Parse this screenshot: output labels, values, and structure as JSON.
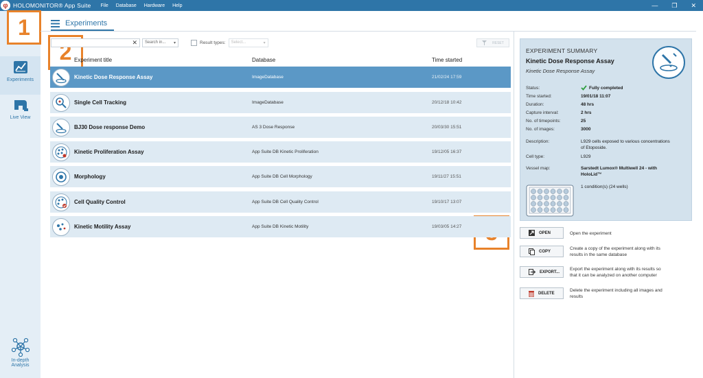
{
  "titlebar": {
    "logo_glyph": "φ",
    "app_name": "HOLOMONITOR® App Suite",
    "menu": [
      "File",
      "Database",
      "Hardware",
      "Help"
    ],
    "min_glyph": "—",
    "max_glyph": "❐",
    "close_glyph": "✕"
  },
  "sidebar": {
    "items": [
      {
        "label": "Experiments",
        "icon": "chart-icon"
      },
      {
        "label": "Live View",
        "icon": "microscope-icon"
      }
    ],
    "bottom": {
      "label_1": "In-depth",
      "label_2": "Analysis",
      "icon": "network-icon"
    }
  },
  "badges": {
    "b1": "1",
    "b2": "2",
    "b3": "3"
  },
  "header": {
    "tab_label": "Experiments",
    "tab_icon": "hamburger-icon"
  },
  "filter": {
    "clear_glyph": "✕",
    "search_in": "Search in...",
    "chevron": "▾",
    "result_types_label": "Result types:",
    "result_select_placeholder": "Select...",
    "reset_label": "RESET"
  },
  "table": {
    "columns": [
      "Experiment title",
      "Database",
      "Time started"
    ],
    "rows": [
      {
        "title": "Kinetic Dose Response Assay",
        "db": "ImageDatabase",
        "time": "21/02/24 17:59",
        "selected": true
      },
      {
        "title": "Single Cell Tracking",
        "db": "ImageDatabase",
        "time": "20/12/18 10:42",
        "selected": false
      },
      {
        "title": "BJ30 Dose response Demo",
        "db": "AS 3 Dose Response",
        "time": "20/03/30 15:51",
        "selected": false
      },
      {
        "title": "Kinetic Proliferation Assay",
        "db": "App Suite DB Kinetic Proliferation",
        "time": "19/12/05 16:37",
        "selected": false
      },
      {
        "title": "Morphology",
        "db": "App Suite DB Cell Morphology",
        "time": "19/11/27 15:51",
        "selected": false
      },
      {
        "title": "Cell Quality Control",
        "db": "App Suite DB Cell Quality Control",
        "time": "19/10/17 13:07",
        "selected": false
      },
      {
        "title": "Kinetic Motility Assay",
        "db": "App Suite DB Kinetic Motility",
        "time": "19/03/05 14:27",
        "selected": false
      }
    ]
  },
  "summary": {
    "heading": "EXPERIMENT SUMMARY",
    "title": "Kinetic Dose Response Assay",
    "subtitle": "Kinetic Dose Response Assay",
    "status_label": "Status:",
    "status_value": "Fully completed",
    "time_started_label": "Time started:",
    "time_started_value": "19/01/18 11:07",
    "duration_label": "Duration:",
    "duration_value": "48 hrs",
    "capture_label": "Capture interval:",
    "capture_value": "2 hrs",
    "timepoints_label": "No. of timepoints:",
    "timepoints_value": "25",
    "images_label": "No. of images:",
    "images_value": "3000",
    "description_label": "Description:",
    "description_line1": "L929 cells exposed to various concentrations",
    "description_line2": "of Etoposide.",
    "celltype_label": "Cell type:",
    "celltype_value": "L929",
    "vessel_label": "Vessel map:",
    "vessel_line1": "Sarstedt Lumox® Multiwell 24 - with",
    "vessel_line2": "HoloLid™",
    "conditions": "1 condition(s) (24 wells)"
  },
  "actions": [
    {
      "label": "OPEN",
      "desc_1": "Open the experiment",
      "desc_2": ""
    },
    {
      "label": "COPY",
      "desc_1": "Create a copy of the experiment along with its",
      "desc_2": "results in the same database"
    },
    {
      "label": "EXPORT...",
      "desc_1": "Export the experiment along with its results so",
      "desc_2": "that it can be analyzed on another computer"
    },
    {
      "label": "DELETE",
      "desc_1": "Delete the experiment including all images and",
      "desc_2": "results"
    }
  ],
  "colors": {
    "accent": "#2e75a8",
    "badge": "#e8822a",
    "selected_row": "#5b98c6",
    "row": "#deeaf3",
    "summary_bg": "#d3e2ed",
    "status_ok": "#2e9e3e",
    "delete_red": "#c0392b"
  }
}
